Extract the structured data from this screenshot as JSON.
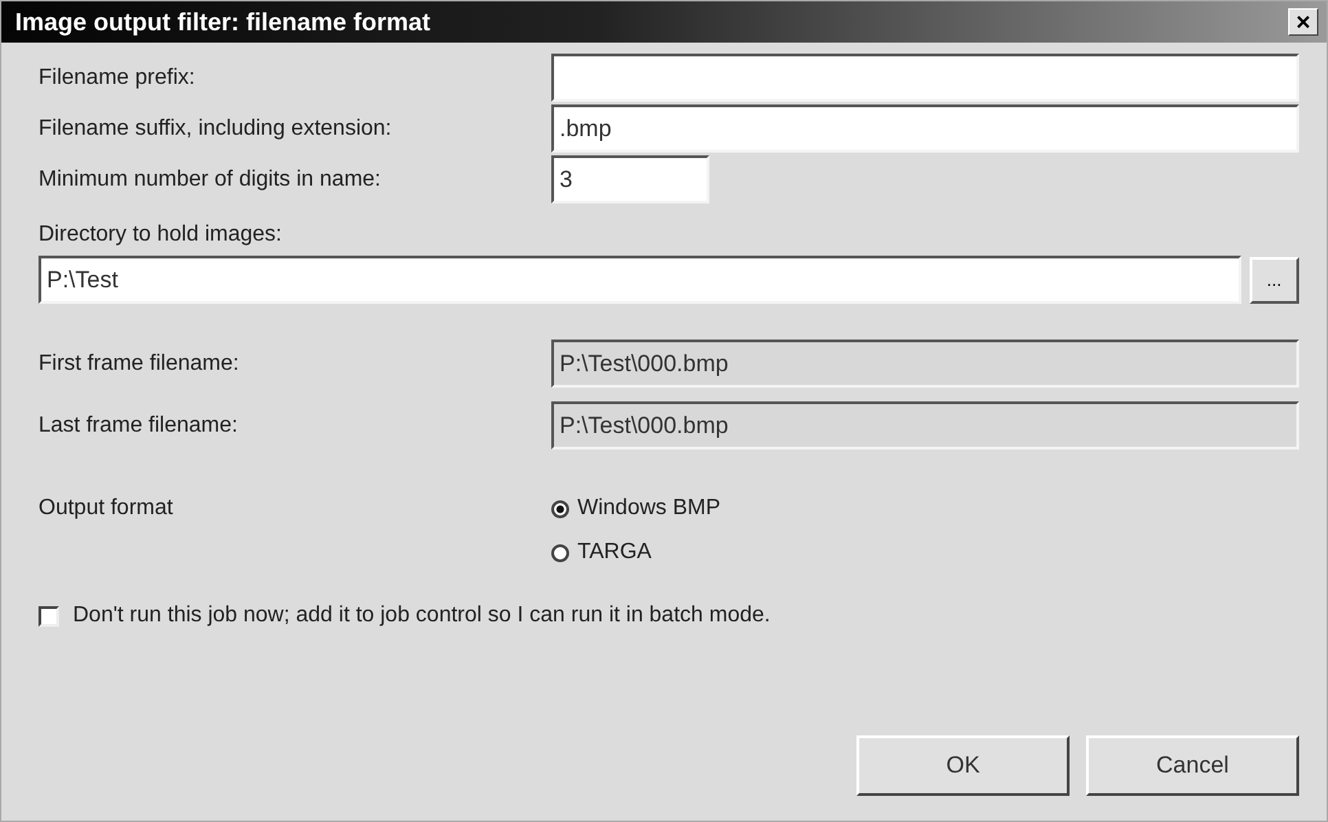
{
  "window": {
    "title": "Image output filter: filename format",
    "close": "×"
  },
  "fields": [
    {
      "label": "Filename prefix:",
      "kind": "wide"
    },
    {
      "label": "Filename suffix, including extension:",
      "value": ".bmp",
      "kind": "wide"
    },
    {
      "label": "Minimum number of digits in name:",
      "value": "3",
      "kind": "short"
    }
  ],
  "directory": {
    "label": "Directory to hold images:",
    "value": "P:\\Test",
    "browse": "..."
  },
  "readouts": [
    {
      "label": "First frame filename:",
      "value": "P:\\Test\\000.bmp",
      "disabled": true
    },
    {
      "label": "Last frame filename:",
      "value": "P:\\Test\\000.bmp",
      "disabled": true
    }
  ],
  "output_format": {
    "label": "Output format",
    "options": [
      {
        "label": "Windows BMP",
        "selected": true
      },
      {
        "label": "TARGA",
        "selected": false
      }
    ]
  },
  "batch": {
    "label": "Don't run this job now; add it to job control so I can run it in batch mode.",
    "checked": false
  },
  "buttons": [
    "OK",
    "Cancel"
  ]
}
